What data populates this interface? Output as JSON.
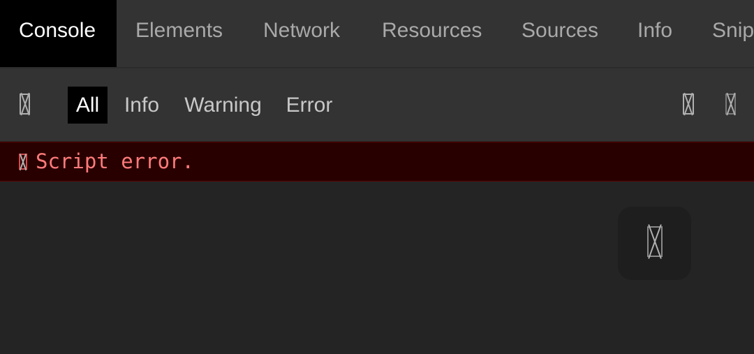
{
  "tabs": [
    {
      "label": "Console",
      "active": true
    },
    {
      "label": "Elements",
      "active": false
    },
    {
      "label": "Network",
      "active": false
    },
    {
      "label": "Resources",
      "active": false
    },
    {
      "label": "Sources",
      "active": false
    },
    {
      "label": "Info",
      "active": false
    },
    {
      "label": "Snip",
      "active": false
    }
  ],
  "toolbar": {
    "clear_icon": "clear-console-icon",
    "filters": [
      {
        "label": "All",
        "active": true
      },
      {
        "label": "Info",
        "active": false
      },
      {
        "label": "Warning",
        "active": false
      },
      {
        "label": "Error",
        "active": false
      }
    ],
    "right_icons": [
      "copy-icon",
      "filter-icon"
    ]
  },
  "console": {
    "entries": [
      {
        "level": "error",
        "icon": "error-icon",
        "text": "Script error."
      }
    ]
  },
  "floating_button": {
    "icon": "tool-icon"
  },
  "colors": {
    "background": "#242424",
    "bar": "#333333",
    "active_tab": "#000000",
    "error_background": "#290000",
    "error_text": "#ff7b7b"
  }
}
